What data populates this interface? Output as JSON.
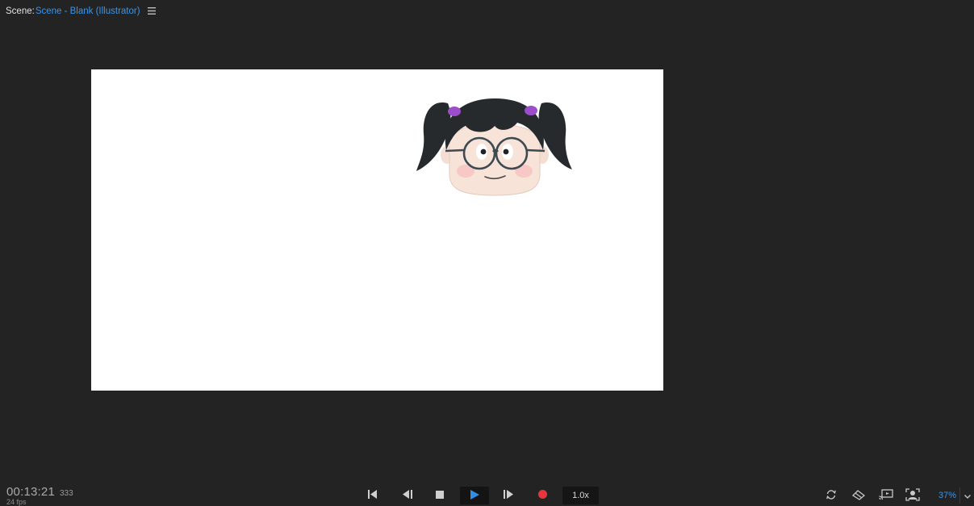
{
  "panel": {
    "scene_label": "Scene:",
    "scene_name": "Scene - Blank (Illustrator)",
    "menu_icon": "hamburger-icon"
  },
  "stage": {
    "background": "#ffffff",
    "puppet": "girl-with-pigtails-and-glasses"
  },
  "status": {
    "timecode": "00:13:21",
    "frame": "333",
    "fps": "24 fps"
  },
  "transport": {
    "buttons": [
      "go-to-start-icon",
      "step-back-icon",
      "stop-icon",
      "play-icon",
      "step-forward-icon",
      "record-icon"
    ],
    "speed": "1.0x",
    "accent": "#2f8fe6",
    "record_color": "#e8343a"
  },
  "tools": {
    "icons": [
      "refresh-icon",
      "eraser-icon",
      "cast-icon",
      "face-tracking-icon"
    ],
    "zoom": "37%",
    "zoom_dropdown": "chevron-down-icon"
  }
}
